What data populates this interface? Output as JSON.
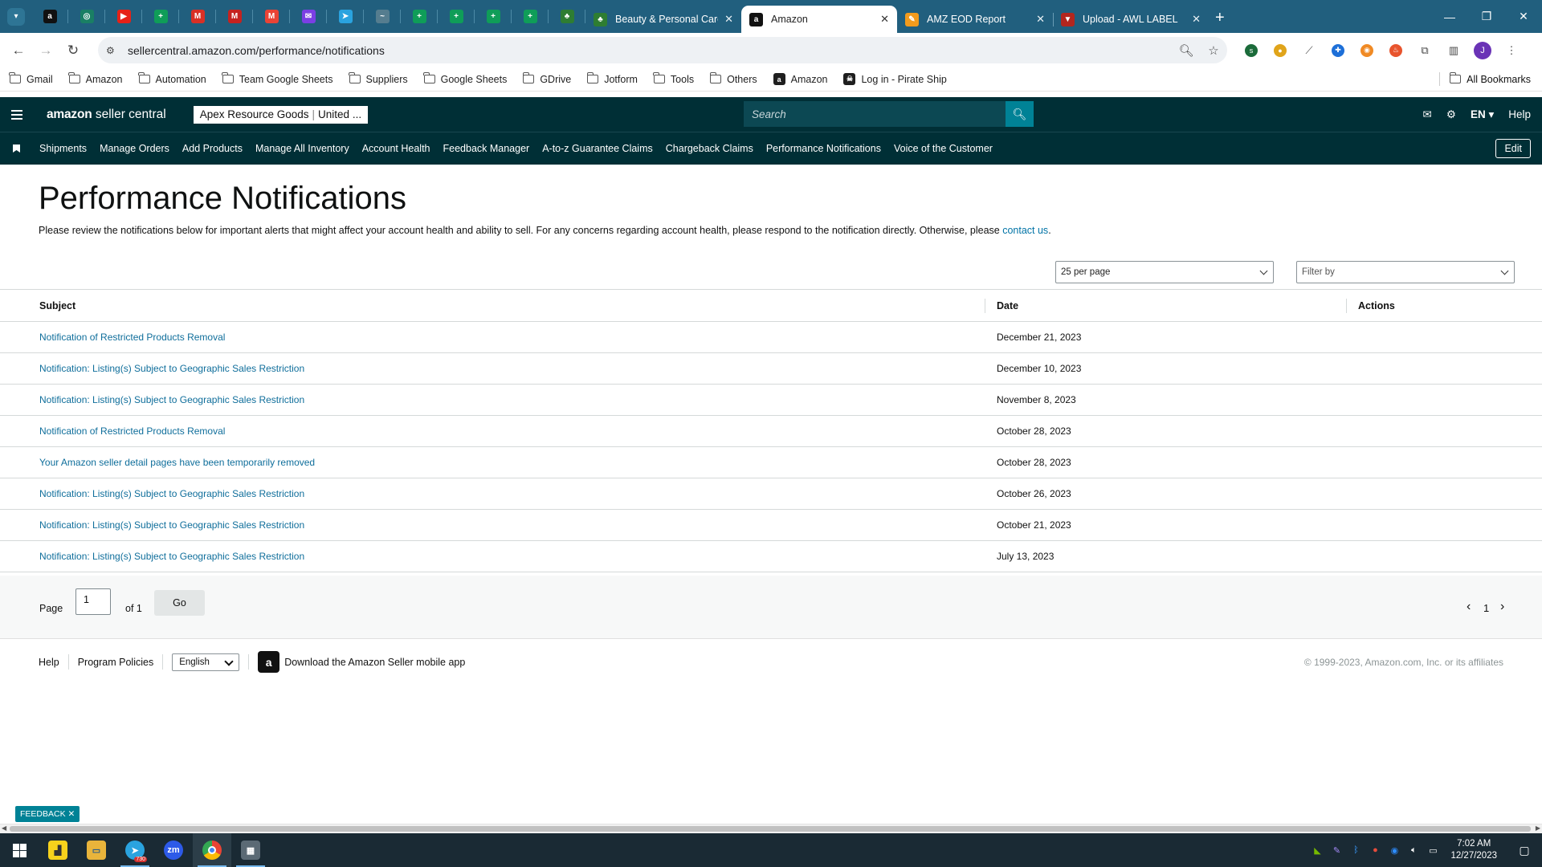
{
  "browser": {
    "pinned_tabs": [
      {
        "icon": "amazon-icon",
        "color": "#111111",
        "glyph": "a"
      },
      {
        "icon": "globe-icon",
        "color": "#1a7f64",
        "glyph": "◎"
      },
      {
        "icon": "youtube-icon",
        "color": "#e62117",
        "glyph": "▶"
      },
      {
        "icon": "google-sheets-icon",
        "color": "#0f9d58",
        "glyph": "+"
      },
      {
        "icon": "gmail-icon",
        "color": "#d93025",
        "glyph": "M"
      },
      {
        "icon": "gmail-icon",
        "color": "#c5221f",
        "glyph": "M"
      },
      {
        "icon": "gmail-icon",
        "color": "#ea4335",
        "glyph": "M"
      },
      {
        "icon": "messenger-icon",
        "color": "#7b3fe4",
        "glyph": "✉"
      },
      {
        "icon": "telegram-icon",
        "color": "#2aa3df",
        "glyph": "➤"
      },
      {
        "icon": "wave-icon",
        "color": "#557d8f",
        "glyph": "~"
      },
      {
        "icon": "google-sheets-icon",
        "color": "#0f9d58",
        "glyph": "+"
      },
      {
        "icon": "google-sheets-icon",
        "color": "#0f9d58",
        "glyph": "+"
      },
      {
        "icon": "google-sheets-icon",
        "color": "#0f9d58",
        "glyph": "+"
      },
      {
        "icon": "google-sheets-icon",
        "color": "#0f9d58",
        "glyph": "+"
      },
      {
        "icon": "leaf-icon",
        "color": "#2e7d32",
        "glyph": "♣"
      }
    ],
    "tabs": [
      {
        "title": "Beauty & Personal Care - Sun &",
        "icon": "leaf-icon",
        "active": false
      },
      {
        "title": "Amazon",
        "icon": "amazon-icon",
        "active": true
      },
      {
        "title": "AMZ EOD Report",
        "icon": "pencil-icon",
        "active": false
      },
      {
        "title": "Upload - AWL LABEL",
        "icon": "awl-icon",
        "active": false
      }
    ],
    "url": "sellercentral.amazon.com/performance/notifications",
    "avatar_initial": "J",
    "bookmarks": [
      {
        "label": "Gmail",
        "type": "folder"
      },
      {
        "label": "Amazon",
        "type": "folder"
      },
      {
        "label": "Automation",
        "type": "folder"
      },
      {
        "label": "Team Google Sheets",
        "type": "folder"
      },
      {
        "label": "Suppliers",
        "type": "folder"
      },
      {
        "label": "Google Sheets",
        "type": "folder"
      },
      {
        "label": "GDrive",
        "type": "folder"
      },
      {
        "label": "Jotform",
        "type": "folder"
      },
      {
        "label": "Tools",
        "type": "folder"
      },
      {
        "label": "Others",
        "type": "folder"
      },
      {
        "label": "Amazon",
        "type": "site"
      },
      {
        "label": "Log in - Pirate Ship",
        "type": "site"
      }
    ],
    "all_bookmarks": "All Bookmarks"
  },
  "seller_central": {
    "logo_bold": "amazon",
    "logo_rest": " seller central",
    "account_name": "Apex Resource Goods",
    "account_region": "United ...",
    "search_placeholder": "Search",
    "language": "EN",
    "help": "Help",
    "nav": [
      "Shipments",
      "Manage Orders",
      "Add Products",
      "Manage All Inventory",
      "Account Health",
      "Feedback Manager",
      "A-to-z Guarantee Claims",
      "Chargeback Claims",
      "Performance Notifications",
      "Voice of the Customer"
    ],
    "edit": "Edit"
  },
  "page": {
    "title": "Performance Notifications",
    "intro_text": "Please review the notifications below for important alerts that might affect your account health and ability to sell. For any concerns regarding account health, please respond to the notification directly. Otherwise, please ",
    "intro_link": "contact us",
    "intro_end": ".",
    "per_page": "25 per page",
    "filter_placeholder": "Filter by",
    "columns": {
      "subject": "Subject",
      "date": "Date",
      "actions": "Actions"
    },
    "rows": [
      {
        "subject": "Notification of Restricted Products Removal",
        "date": "December 21, 2023"
      },
      {
        "subject": "Notification: Listing(s) Subject to Geographic Sales Restriction",
        "date": "December 10, 2023"
      },
      {
        "subject": "Notification: Listing(s) Subject to Geographic Sales Restriction",
        "date": "November 8, 2023"
      },
      {
        "subject": "Notification of Restricted Products Removal",
        "date": "October 28, 2023"
      },
      {
        "subject": "Your Amazon seller detail pages have been temporarily removed",
        "date": "October 28, 2023"
      },
      {
        "subject": "Notification: Listing(s) Subject to Geographic Sales Restriction",
        "date": "October 26, 2023"
      },
      {
        "subject": "Notification: Listing(s) Subject to Geographic Sales Restriction",
        "date": "October 21, 2023"
      },
      {
        "subject": "Notification: Listing(s) Subject to Geographic Sales Restriction",
        "date": "July 13, 2023"
      }
    ],
    "pagination": {
      "label": "Page",
      "value": "1",
      "of": "of 1",
      "go": "Go",
      "current": "1"
    }
  },
  "footer": {
    "help": "Help",
    "policies": "Program Policies",
    "language": "English",
    "app": "Download the Amazon Seller mobile app",
    "copyright": "© 1999-2023, Amazon.com, Inc. or its affiliates"
  },
  "feedback": "FEEDBACK",
  "taskbar": {
    "time": "7:02 AM",
    "date": "12/27/2023",
    "telegram_badge": "730",
    "zoom_label": "zm"
  },
  "colors": {
    "tab_strip": "#215f7e",
    "seller_header": "#002f36",
    "link": "#0f6e9b",
    "search_button": "#008296"
  }
}
